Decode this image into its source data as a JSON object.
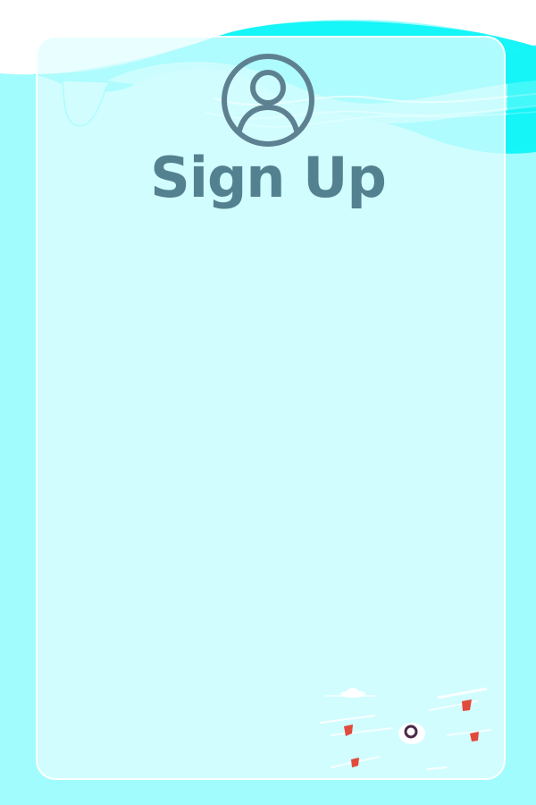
{
  "header": {
    "title": "Sign Up"
  },
  "icons": {
    "avatar": "user-circle-icon",
    "decoration": "rocket-illustration"
  },
  "colors": {
    "background": "#a0fcfd",
    "card": "#e1fdff",
    "accent_cyan": "#16f5f7",
    "title": "#53818f",
    "avatar_stroke": "#5e8191",
    "rocket_fins": "#e24a3b",
    "rocket_window": "#4a2a47"
  }
}
